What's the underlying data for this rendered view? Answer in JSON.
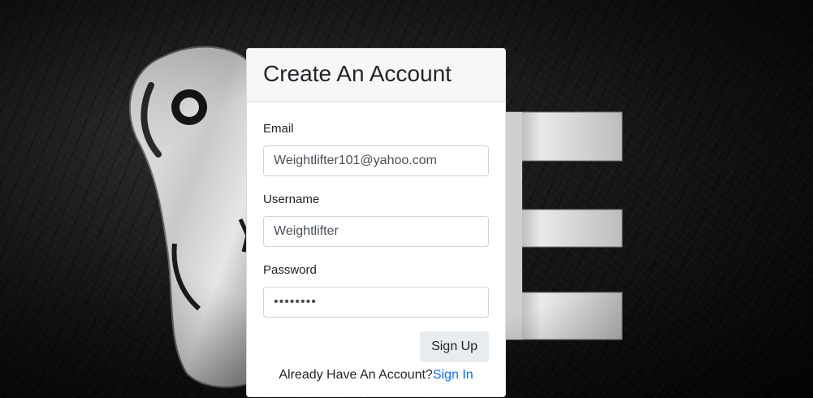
{
  "form": {
    "title": "Create An Account",
    "email_label": "Email",
    "email_value": "Weightlifter101@yahoo.com",
    "username_label": "Username",
    "username_value": "Weightlifter",
    "password_label": "Password",
    "password_value": "password",
    "submit_label": "Sign Up",
    "signin_prompt": "Already Have An Account?",
    "signin_link": "Sign In"
  },
  "colors": {
    "link": "#0d6efd",
    "header_bg": "#f7f7f7",
    "button_bg": "#e9ecef"
  }
}
